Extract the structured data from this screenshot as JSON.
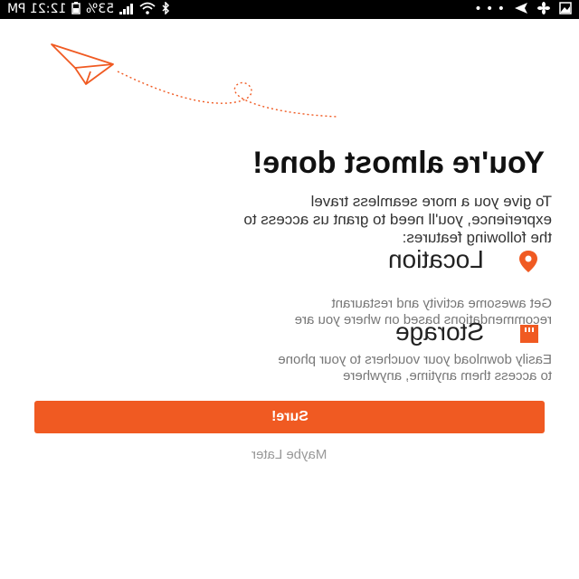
{
  "status_bar": {
    "time": "12:21 PM",
    "battery_percent": "53%",
    "overflow_dots": "• • •"
  },
  "illustration": {
    "icon": "paper-plane-icon",
    "color": "#f05a22"
  },
  "title": "You're almost done!",
  "intro_lines": [
    "To give you a more seamless travel",
    "exprerience, you'll need to grant us access to",
    "the following features:"
  ],
  "features": [
    {
      "title": "Location",
      "icon": "location-pin-icon",
      "desc_lines": [
        "Get awesome activity and restaurant",
        "recommendations based on where you are"
      ]
    },
    {
      "title": "Storage",
      "icon": "sd-card-icon",
      "desc_lines": [
        "Easily download your vouchers to your phone",
        "to access them anytime, anywhere"
      ]
    }
  ],
  "actions": {
    "primary_label": "Sure!",
    "secondary_label": "Maybe Later",
    "accent_color": "#f05a22"
  }
}
